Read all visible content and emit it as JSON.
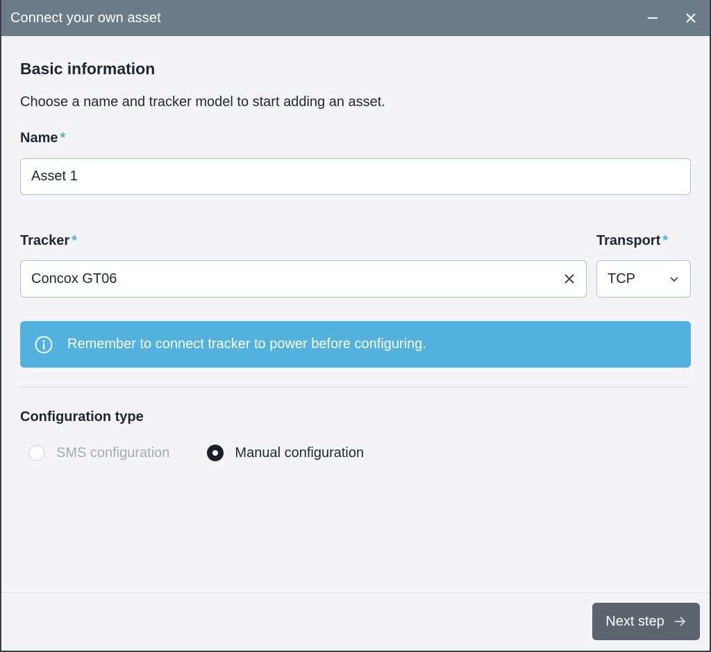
{
  "window": {
    "title": "Connect your own asset",
    "minimize_icon": "minimize-icon",
    "close_icon": "close-icon"
  },
  "basic_info": {
    "title": "Basic information",
    "subtitle": "Choose a name and tracker model to start adding an asset."
  },
  "name_field": {
    "label": "Name",
    "required_mark": "*",
    "value": "Asset 1"
  },
  "tracker_field": {
    "label": "Tracker",
    "required_mark": "*",
    "value": "Concox GT06",
    "clear_icon": "close-icon"
  },
  "transport_field": {
    "label": "Transport",
    "required_mark": "*",
    "value": "TCP",
    "dropdown_icon": "chevron-down-icon"
  },
  "info_banner": {
    "icon": "info-icon",
    "text": "Remember to connect tracker to power before configuring."
  },
  "configuration": {
    "title": "Configuration type",
    "options": [
      {
        "label": "SMS configuration",
        "selected": false,
        "disabled": true
      },
      {
        "label": "Manual configuration",
        "selected": true,
        "disabled": false
      }
    ]
  },
  "footer": {
    "next_label": "Next step",
    "next_icon": "arrow-right-icon"
  },
  "colors": {
    "titlebar": "#6b7b88",
    "accent": "#52b1dd",
    "required": "#4eb0dc",
    "primary_button": "#5b6570",
    "background": "#f4f4f6"
  }
}
